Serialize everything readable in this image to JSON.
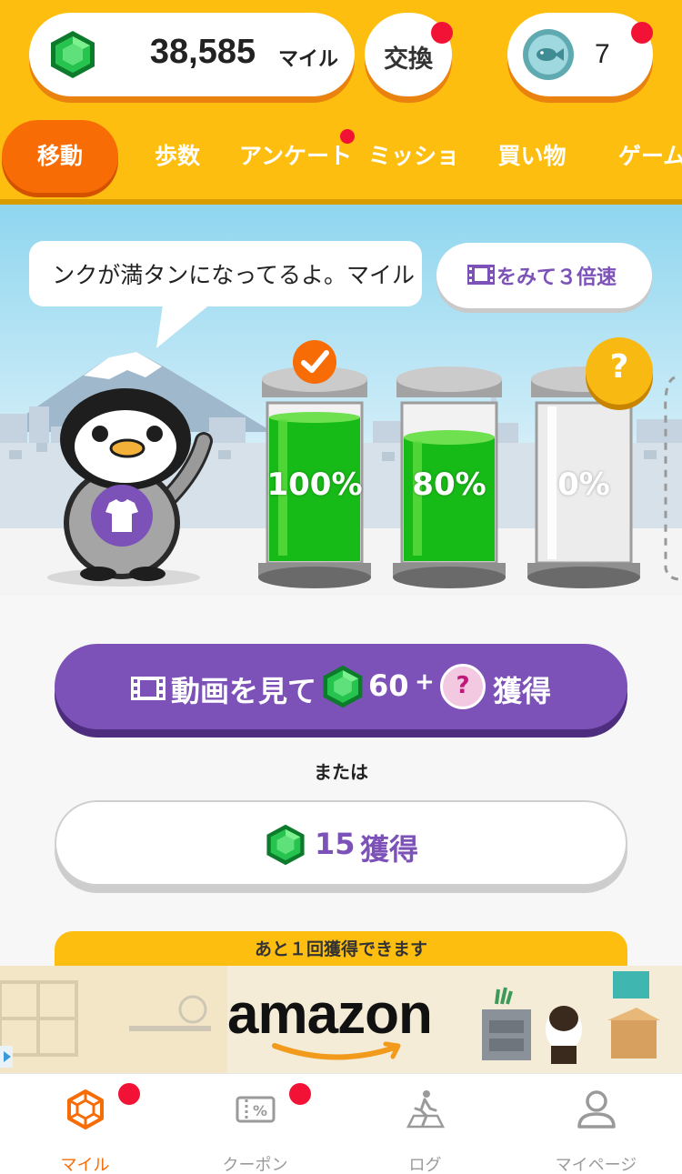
{
  "header": {
    "miles_value": "38,585",
    "miles_unit": "マイル",
    "exchange_label": "交換",
    "fish_count": "7"
  },
  "tabs": [
    {
      "label": "移動",
      "active": true
    },
    {
      "label": "歩数"
    },
    {
      "label": "アンケート",
      "badge": true
    },
    {
      "label": "ミッション"
    },
    {
      "label": "買い物"
    },
    {
      "label": "ゲーム"
    }
  ],
  "scene": {
    "speech_text": "ンクが満タンになってるよ。マイル",
    "video_button_label": "をみて３倍速",
    "tanks": [
      {
        "label": "100%",
        "fill": 1.0,
        "status": "check"
      },
      {
        "label": "80%",
        "fill": 0.8
      },
      {
        "label": "0%",
        "fill": 0.0,
        "status": "question"
      }
    ],
    "question_mark": "?"
  },
  "actions": {
    "watch_prefix": "動画を見て",
    "watch_amount": "60",
    "watch_plus": "+",
    "watch_suffix": "獲得",
    "watch_bonus_mark": "?",
    "or_label": "または",
    "earn_amount": "15",
    "earn_suffix": "獲得",
    "remaining_text": "あと１回獲得できます"
  },
  "ad": {
    "brand": "amazon"
  },
  "bottom_nav": [
    {
      "label": "マイル",
      "icon": "gem-outline-icon",
      "active": true,
      "badge": true
    },
    {
      "label": "クーポン",
      "icon": "coupon-icon",
      "badge": true
    },
    {
      "label": "ログ",
      "icon": "walking-log-icon"
    },
    {
      "label": "マイページ",
      "icon": "person-icon"
    }
  ],
  "colors": {
    "header_yellow": "#fdbe10",
    "active_orange": "#f86c05",
    "purple": "#7c52b8",
    "badge_red": "#f21236",
    "gem_green": "#1fb44a"
  }
}
